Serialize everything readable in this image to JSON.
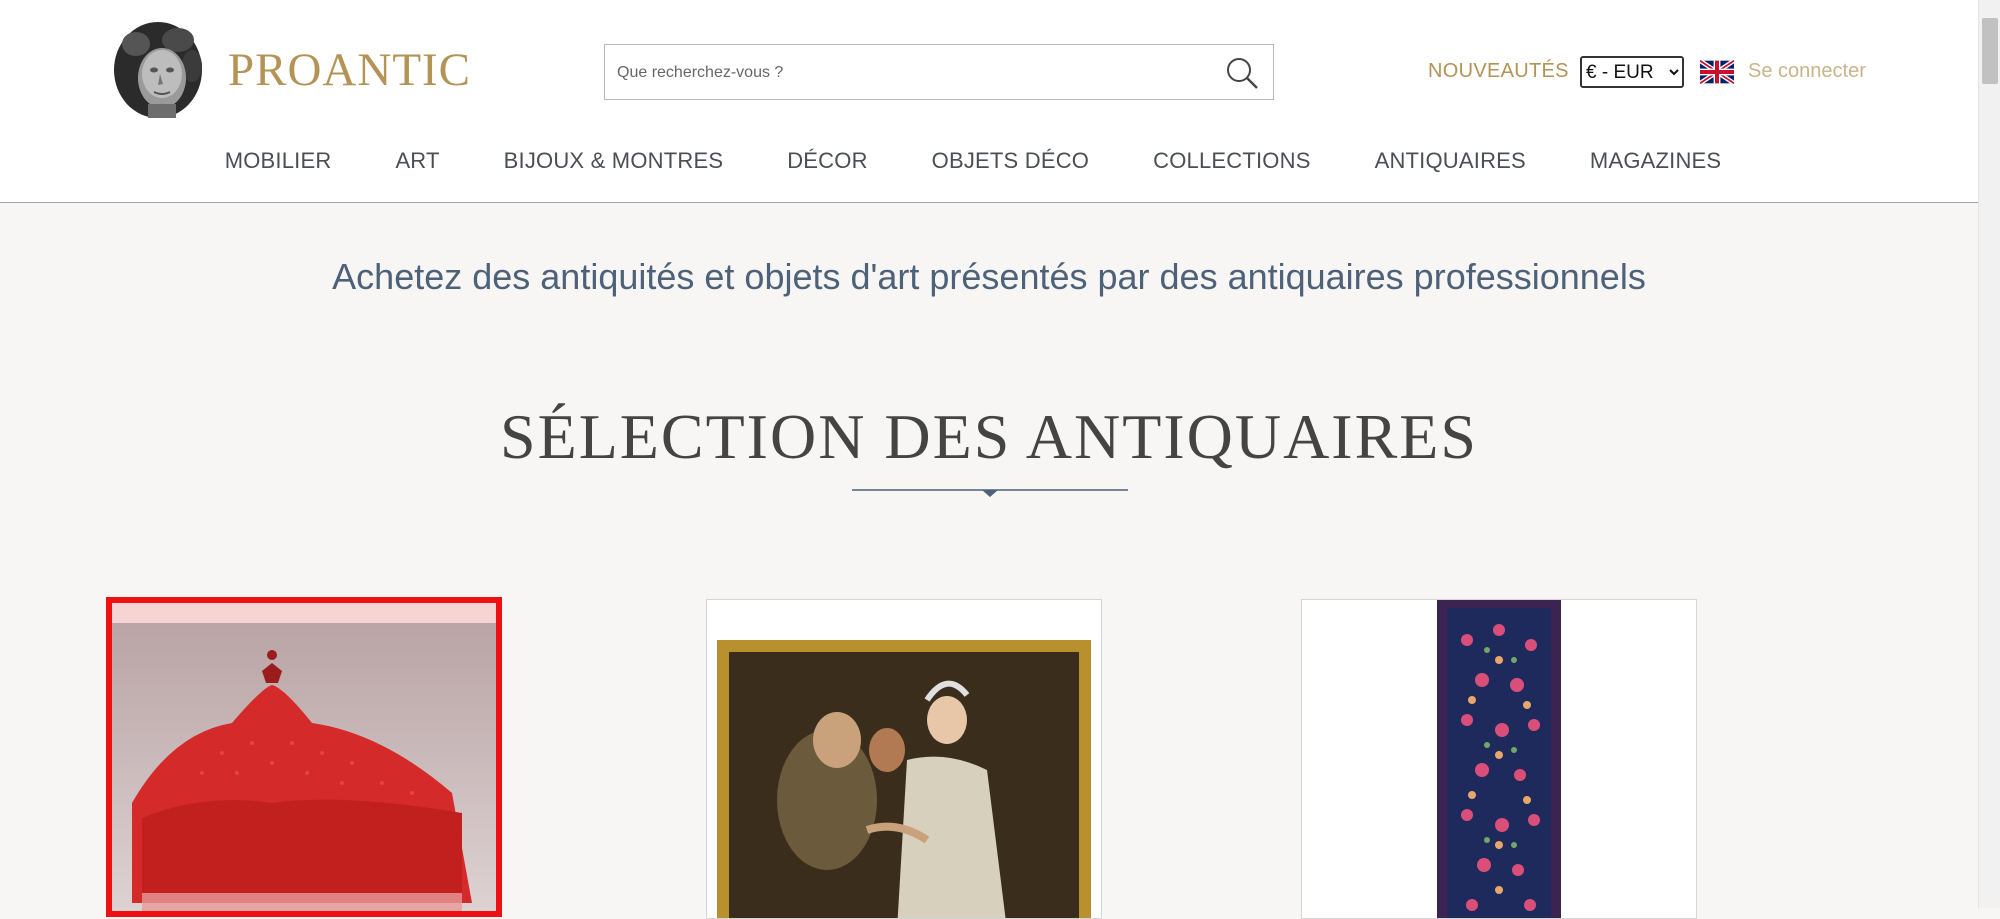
{
  "header": {
    "logo_text": "PROANTIC",
    "search_placeholder": "Que recherchez-vous ?",
    "nouveautes": "NOUVEAUTÉS",
    "currency_selected": "€ - EUR",
    "login": "Se connecter"
  },
  "nav": {
    "items": [
      "MOBILIER",
      "ART",
      "BIJOUX & MONTRES",
      "DÉCOR",
      "OBJETS DÉCO",
      "COLLECTIONS",
      "ANTIQUAIRES",
      "MAGAZINES"
    ]
  },
  "main": {
    "tagline": "Achetez des antiquités et objets d'art présentés par des antiquaires professionnels",
    "section_title": "SÉLECTION DES ANTIQUAIRES",
    "cards": [
      {
        "image": "red-velvet-corner-sofa-photo"
      },
      {
        "image": "gilt-framed-painting-photo"
      },
      {
        "image": "oriental-runner-rug-photo"
      }
    ]
  },
  "colors": {
    "gold": "#b39356",
    "blue_grey": "#4d6178",
    "highlight_red": "#ee1111"
  }
}
